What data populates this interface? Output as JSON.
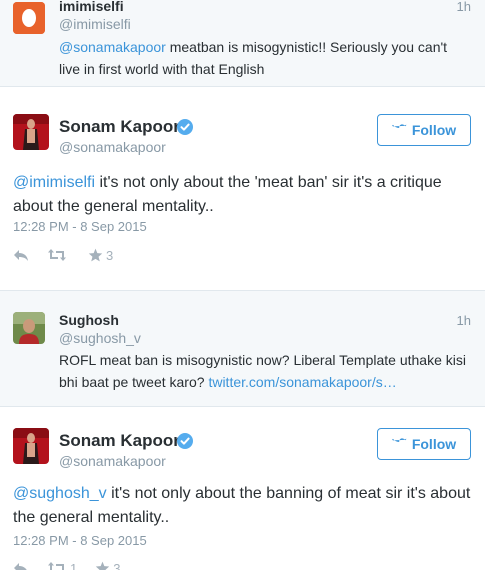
{
  "tweets": [
    {
      "name": "imimiselfi",
      "handle": "@imimiselfi",
      "time": "1h",
      "mention": "@sonamakapoor",
      "text": " meatban is misogynistic!! Seriously you can't live in first world with that English"
    },
    {
      "name": "Sonam Kapoor",
      "handle": "@sonamakapoor",
      "follow_label": "Follow",
      "mention": "@imimiselfi",
      "text": " it's not only about the 'meat ban' sir it's a critique about the general mentality..",
      "timestamp": "12:28 PM - 8 Sep 2015",
      "retweets": "",
      "favorites": "3"
    },
    {
      "name": "Sughosh",
      "handle": "@sughosh_v",
      "time": "1h",
      "text": "ROFL meat ban is misogynistic now? Liberal Template uthake kisi bhi baat pe tweet karo? ",
      "link": "twitter.com/sonamakapoor/s…"
    },
    {
      "name": "Sonam Kapoor",
      "handle": "@sonamakapoor",
      "follow_label": "Follow",
      "mention": "@sughosh_v",
      "text": " it's not only about the banning of meat sir it's about the general mentality..",
      "timestamp": "12:28 PM - 8 Sep 2015",
      "retweets": "1",
      "favorites": "3"
    }
  ],
  "colors": {
    "link": "#3b94d9",
    "muted": "#8899a6",
    "verified": "#55acee",
    "reply_bg": "#f5f8fa"
  }
}
